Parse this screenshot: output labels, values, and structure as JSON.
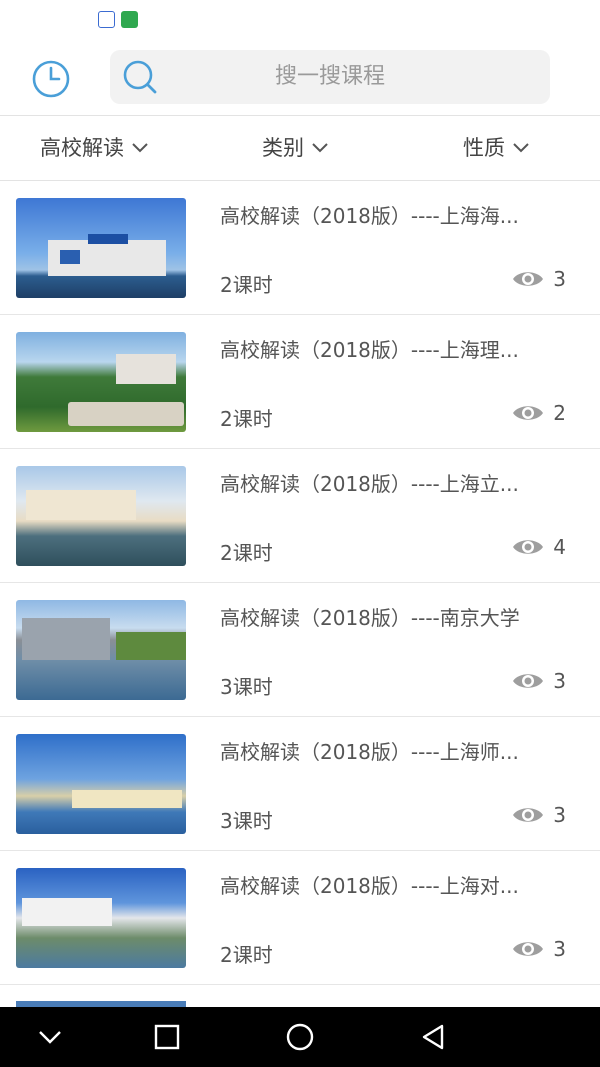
{
  "search": {
    "placeholder": "搜一搜课程"
  },
  "filters": [
    {
      "label": "高校解读"
    },
    {
      "label": "类别"
    },
    {
      "label": "性质"
    }
  ],
  "courses": [
    {
      "title": "高校解读（2018版）----上海海...",
      "hours": "2课时",
      "views": "3"
    },
    {
      "title": "高校解读（2018版）----上海理...",
      "hours": "2课时",
      "views": "2"
    },
    {
      "title": "高校解读（2018版）----上海立...",
      "hours": "2课时",
      "views": "4"
    },
    {
      "title": "高校解读（2018版）----南京大学",
      "hours": "3课时",
      "views": "3"
    },
    {
      "title": "高校解读（2018版）----上海师...",
      "hours": "3课时",
      "views": "3"
    },
    {
      "title": "高校解读（2018版）----上海对...",
      "hours": "2课时",
      "views": "3"
    }
  ],
  "colors": {
    "accent": "#4a9fd8",
    "text": "#555555",
    "muted": "#9a9a9a"
  },
  "icons": [
    "clock-icon",
    "search-icon",
    "chevron-down-icon",
    "eye-icon",
    "nav-back-icon",
    "nav-home-icon",
    "nav-recents-icon"
  ]
}
